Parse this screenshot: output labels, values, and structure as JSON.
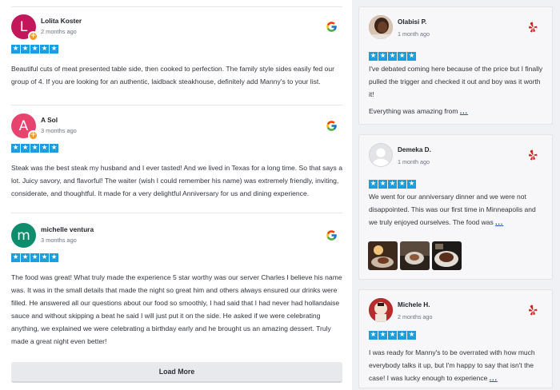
{
  "reviews": [
    {
      "name": "Lolita Koster",
      "time": "2 months ago",
      "initial": "L",
      "color": "#c2185b",
      "rating": 5,
      "text": "Beautiful cuts of meat presented table side, then cooked to perfection. The family style sides easily fed our group of 4. If you are looking for an authentic, laidback steakhouse, definitely add Manny's to your list."
    },
    {
      "name": "A Sol",
      "time": "3 months ago",
      "initial": "A",
      "color": "#e8436f",
      "rating": 5,
      "text": "Steak was the best steak my husband and I ever tasted! And we lived in Texas for a long time. So that says a lot. Juicy savory, and flavorful! The waiter (wish I could remember his name) was extremely friendly, inviting, considerate, and thoughtful. It made for a very delightful Anniversary for us and dining experience."
    },
    {
      "name": "michelle ventura",
      "time": "3 months ago",
      "initial": "m",
      "color": "#0f8c6e",
      "rating": 5,
      "text": "The food was great! What truly made the experience 5 star worthy was our server Charles I believe his name was. It was in the small details that made the night so great him and others always ensured our drinks were filled. He answered all our questions about our food so smoothly, I had said that I had never had hollandaise sauce and without skipping a beat he said I will just put it on the side. He asked if we were celebrating anything, we explained we were celebrating a birthday early and he brought us an amazing dessert. Truly made a great night even better!"
    }
  ],
  "load_more_label": "Load More",
  "cards": [
    {
      "name": "Olabisi P.",
      "time": "1 month ago",
      "rating": 5,
      "text1": "I've debated coming here because of the price but I finally pulled the trigger and checked it out and boy was it worth it!",
      "text2": "Everything was amazing from",
      "more": "..."
    },
    {
      "name": "Demeka D.",
      "time": "1 month ago",
      "rating": 5,
      "text1": "We went for our anniversary dinner and we were not disappointed. This was our first time in Minneapolis and we truly enjoyed ourselves. The food was",
      "more": "..."
    },
    {
      "name": "Michele H.",
      "time": "2 months ago",
      "rating": 5,
      "text1": "I was ready for Manny's to be overrated with how much everybody talks it up, but I'm happy to say that isn't the case! I was lucky enough to experience",
      "more": "..."
    }
  ],
  "icons": {
    "google": "google-icon",
    "yelp": "yelp-icon",
    "star": "star-icon"
  },
  "colors": {
    "star_bg": "#1b9de0",
    "yelp_red": "#d32323",
    "badge": "#f39a2d"
  }
}
